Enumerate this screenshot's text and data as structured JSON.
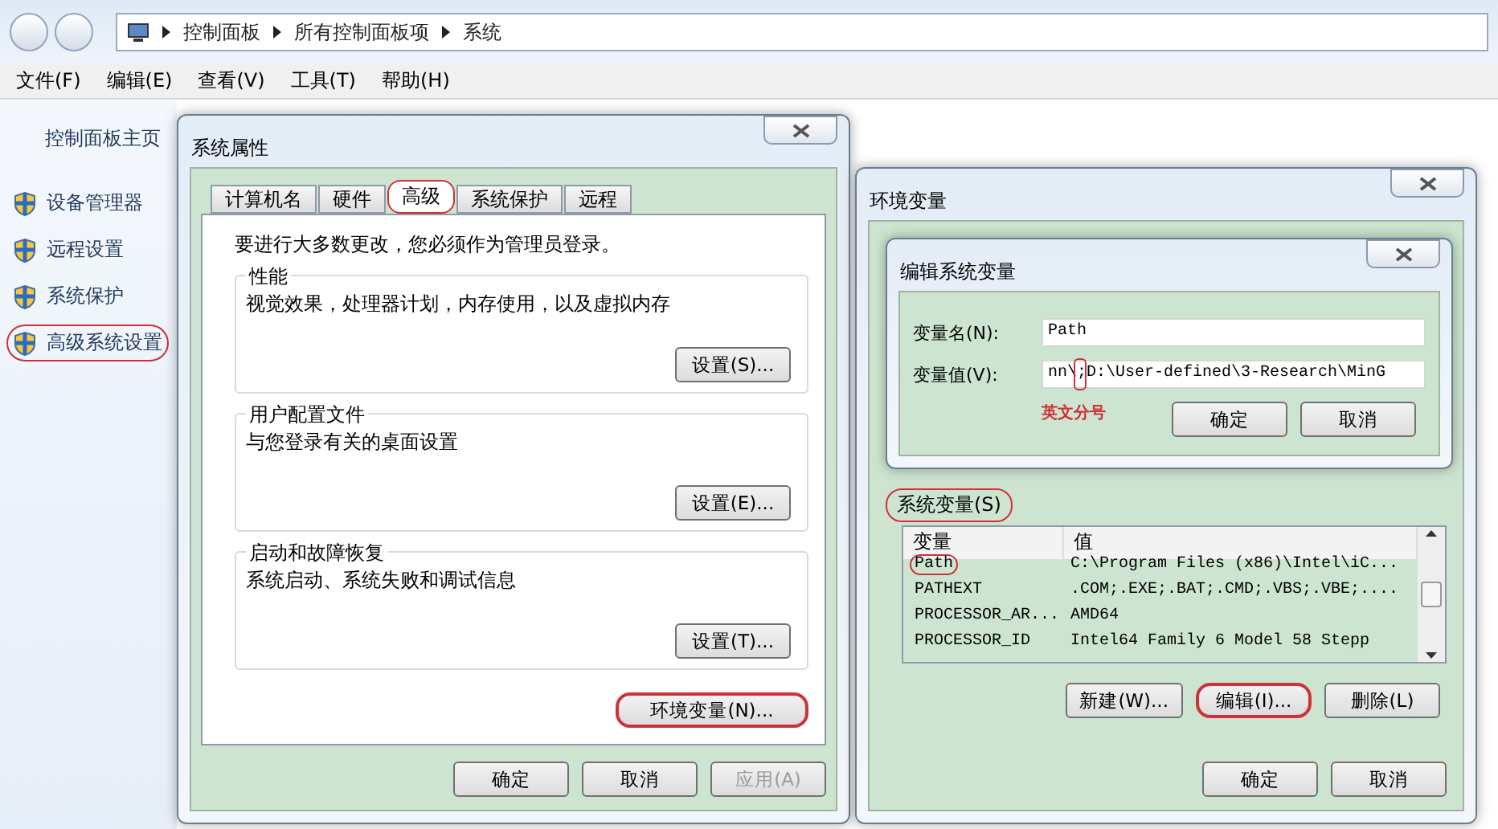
{
  "explorer": {
    "breadcrumb": [
      "控制面板",
      "所有控制面板项",
      "系统"
    ],
    "menu": [
      "文件(F)",
      "编辑(E)",
      "查看(V)",
      "工具(T)",
      "帮助(H)"
    ],
    "sidebar": {
      "home": "控制面板主页",
      "links": [
        {
          "label": "设备管理器",
          "highlighted": false
        },
        {
          "label": "远程设置",
          "highlighted": false
        },
        {
          "label": "系统保护",
          "highlighted": false
        },
        {
          "label": "高级系统设置",
          "highlighted": true
        }
      ]
    }
  },
  "system_properties": {
    "title": "系统属性",
    "tabs": [
      {
        "label": "计算机名",
        "selected": false,
        "highlighted": false
      },
      {
        "label": "硬件",
        "selected": false,
        "highlighted": false
      },
      {
        "label": "高级",
        "selected": true,
        "highlighted": true
      },
      {
        "label": "系统保护",
        "selected": false,
        "highlighted": false
      },
      {
        "label": "远程",
        "selected": false,
        "highlighted": false
      }
    ],
    "notice": "要进行大多数更改，您必须作为管理员登录。",
    "groups": [
      {
        "title": "性能",
        "description": "视觉效果，处理器计划，内存使用，以及虚拟内存",
        "button": "设置(S)..."
      },
      {
        "title": "用户配置文件",
        "description": "与您登录有关的桌面设置",
        "button": "设置(E)..."
      },
      {
        "title": "启动和故障恢复",
        "description": "系统启动、系统失败和调试信息",
        "button": "设置(T)..."
      }
    ],
    "env_button": {
      "label": "环境变量(N)...",
      "highlighted": true
    },
    "buttons": [
      {
        "label": "确定",
        "disabled": false
      },
      {
        "label": "取消",
        "disabled": false
      },
      {
        "label": "应用(A)",
        "disabled": true
      }
    ]
  },
  "env_vars": {
    "title": "环境变量",
    "edit_dialog": {
      "title": "编辑系统变量",
      "fields": [
        {
          "label": "变量名(N):",
          "value": "Path",
          "marked": false
        },
        {
          "label": "变量值(V):",
          "value": "nn\\;D:\\User-defined\\3-Research\\MinG",
          "marked": true
        }
      ],
      "annotation": "英文分号",
      "buttons": [
        "确定",
        "取消"
      ]
    },
    "system_vars": {
      "label": "系统变量(S)",
      "highlighted": true,
      "columns": [
        "变量",
        "值"
      ],
      "rows": [
        {
          "name": "Path",
          "value": "C:\\Program Files (x86)\\Intel\\iC...",
          "highlighted": true
        },
        {
          "name": "PATHEXT",
          "value": ".COM;.EXE;.BAT;.CMD;.VBS;.VBE;....",
          "highlighted": false
        },
        {
          "name": "PROCESSOR_AR...",
          "value": "AMD64",
          "highlighted": false
        },
        {
          "name": "PROCESSOR_ID",
          "value": "Intel64 Family 6 Model 58 Stepp",
          "highlighted": false
        }
      ]
    },
    "list_buttons": [
      {
        "label": "新建(W)...",
        "highlighted": false
      },
      {
        "label": "编辑(I)...",
        "highlighted": true
      },
      {
        "label": "删除(L)",
        "highlighted": false
      }
    ],
    "buttons": [
      "确定",
      "取消"
    ]
  }
}
